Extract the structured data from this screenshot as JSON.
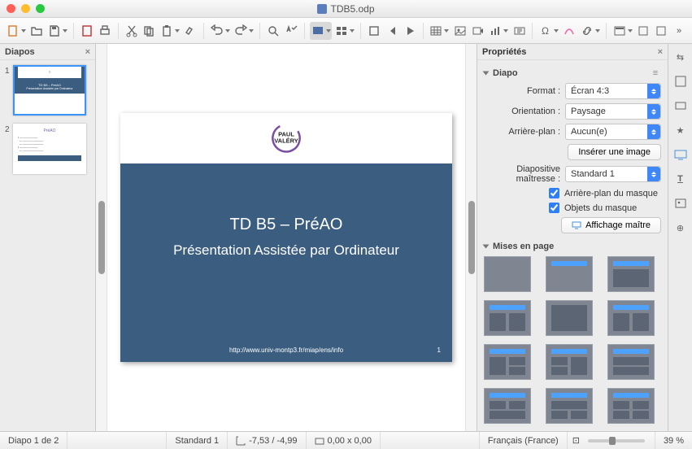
{
  "window": {
    "title": "TDB5.odp"
  },
  "traffic": {
    "close": "#ff5f57",
    "min": "#ffbd2e",
    "max": "#28c940"
  },
  "panels": {
    "slides_title": "Diapos",
    "props_title": "Propriétés"
  },
  "slide": {
    "title1": "TD B5 – PréAO",
    "title2": "Présentation Assistée par Ordinateur",
    "url": "http://www.univ-montp3.fr/miap/ens/info",
    "page_no": "1",
    "logo_line1": "PAUL",
    "logo_line2": "VALÉRY"
  },
  "thumbs": {
    "n1": "1",
    "n2": "2",
    "t2_title": "PréAO"
  },
  "props": {
    "sec_diapo": "Diapo",
    "format_label": "Format :",
    "format_value": "Écran 4:3",
    "orient_label": "Orientation :",
    "orient_value": "Paysage",
    "bg_label": "Arrière-plan :",
    "bg_value": "Aucun(e)",
    "insert_image": "Insérer une image",
    "master_label": "Diapositive maîtresse :",
    "master_value": "Standard 1",
    "chk_bg": "Arrière-plan du masque",
    "chk_obj": "Objets du masque",
    "view_master": "Affichage maître",
    "sec_layouts": "Mises en page"
  },
  "status": {
    "slide_pos": "Diapo 1 de 2",
    "template": "Standard 1",
    "coords": "-7,53 / -4,99",
    "size": "0,00 x 0,00",
    "lang": "Français (France)",
    "zoom": "39 %"
  }
}
